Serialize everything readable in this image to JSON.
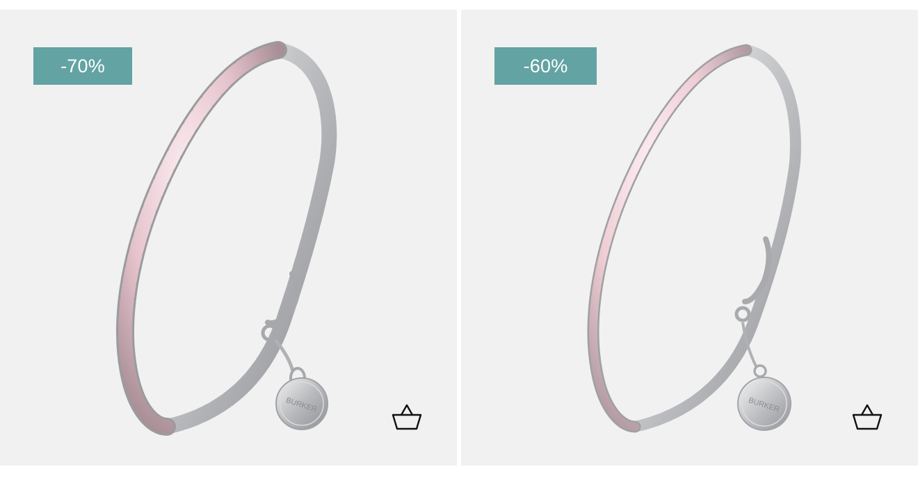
{
  "products": [
    {
      "discount_label": "-70%",
      "charm_text": "BURKER",
      "basket_icon": "shopping-basket-icon",
      "stone_color": "#e6c3cc",
      "metal_color": "#c9cacc"
    },
    {
      "discount_label": "-60%",
      "charm_text": "BURKER",
      "basket_icon": "shopping-basket-icon",
      "stone_color": "#efcdd5",
      "metal_color": "#cfd0d2"
    }
  ],
  "colors": {
    "card_background": "#f1f1f1",
    "badge_background": "#63a3a3",
    "badge_text": "#ffffff",
    "icon_stroke": "#111111"
  }
}
